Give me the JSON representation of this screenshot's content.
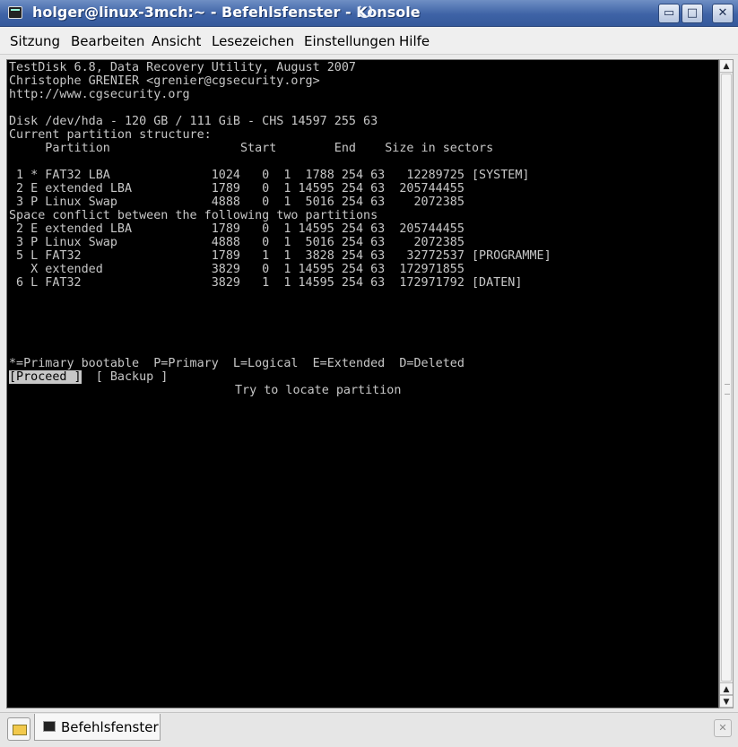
{
  "window": {
    "title": "holger@linux-3mch:~ - Befehlsfenster - Konsole",
    "minimize_glyph": "▭",
    "maximize_glyph": "□",
    "close_glyph": "✕"
  },
  "menu": {
    "items": [
      "Sitzung",
      "Bearbeiten",
      "Ansicht",
      "Lesezeichen",
      "Einstellungen",
      "Hilfe"
    ]
  },
  "terminal": {
    "header": [
      "TestDisk 6.8, Data Recovery Utility, August 2007",
      "Christophe GRENIER <grenier@cgsecurity.org>",
      "http://www.cgsecurity.org"
    ],
    "disk_info": "Disk /dev/hda - 120 GB / 111 GiB - CHS 14597 255 63",
    "structure_title": "Current partition structure:",
    "column_header": "     Partition                  Start        End    Size in sectors",
    "partitions": [
      " 1 * FAT32 LBA              1024   0  1  1788 254 63   12289725 [SYSTEM]",
      " 2 E extended LBA           1789   0  1 14595 254 63  205744455",
      " 3 P Linux Swap             4888   0  1  5016 254 63    2072385"
    ],
    "conflict_message": "Space conflict between the following two partitions",
    "conflict_partitions": [
      " 2 E extended LBA           1789   0  1 14595 254 63  205744455",
      " 3 P Linux Swap             4888   0  1  5016 254 63    2072385",
      " 5 L FAT32                  1789   1  1  3828 254 63   32772537 [PROGRAMME]",
      "   X extended               3829   0  1 14595 254 63  172971855",
      " 6 L FAT32                  3829   1  1 14595 254 63  172971792 [DATEN]"
    ],
    "legend": "*=Primary bootable  P=Primary  L=Logical  E=Extended  D=Deleted",
    "proceed_label": "[Proceed ]",
    "backup_label": "[ Backup ]",
    "hint": "Try to locate partition"
  },
  "scrollbar": {
    "up_glyph": "▲",
    "down_glyph": "▼"
  },
  "tabs": [
    {
      "label": "Befehlsfenster"
    }
  ],
  "tabbar": {
    "close_glyph": "✕"
  }
}
